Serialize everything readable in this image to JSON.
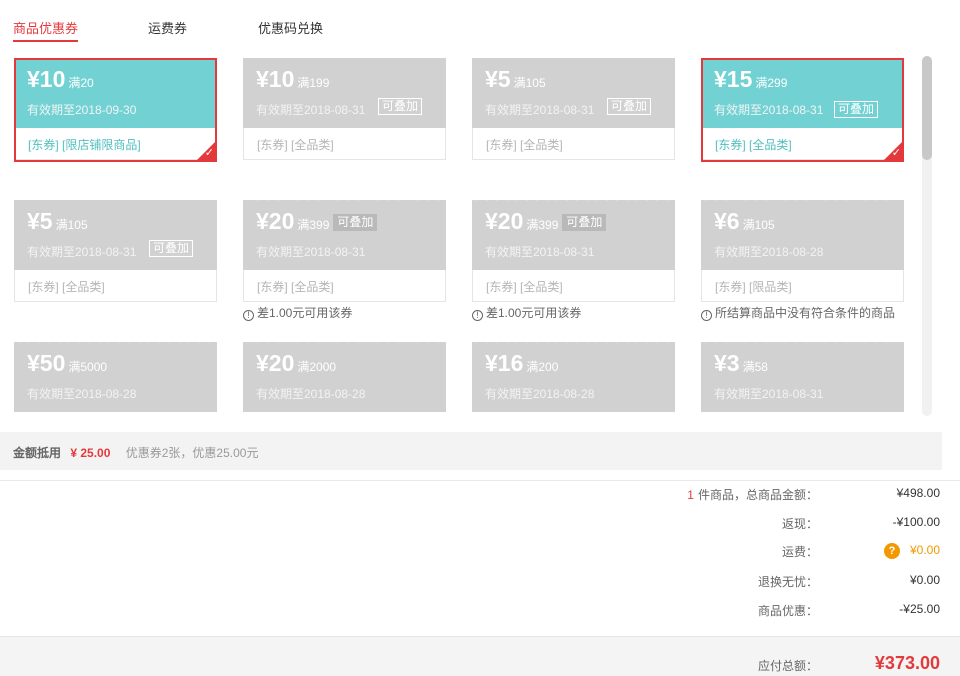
{
  "tabs": [
    {
      "label": "商品优惠券",
      "active": true
    },
    {
      "label": "运费券",
      "active": false
    },
    {
      "label": "优惠码兑换",
      "active": false
    }
  ],
  "coupons": [
    {
      "amount": "¥10",
      "condition": "满20",
      "validity": "有效期至2018-09-30",
      "stackable": "",
      "scope": "[东券]  [限店铺限商品]",
      "selected": true
    },
    {
      "amount": "¥10",
      "condition": "满199",
      "validity": "有效期至2018-08-31",
      "stackable": "可叠加",
      "scope": "[东券]  [全品类]",
      "selected": false
    },
    {
      "amount": "¥5",
      "condition": "满105",
      "validity": "有效期至2018-08-31",
      "stackable": "可叠加",
      "scope": "[东券]  [全品类]",
      "selected": false
    },
    {
      "amount": "¥15",
      "condition": "满299",
      "validity": "有效期至2018-08-31",
      "stackable": "可叠加",
      "scope": "[东券]  [全品类]",
      "selected": true
    },
    {
      "amount": "¥5",
      "condition": "满105",
      "validity": "有效期至2018-08-31",
      "stackable": "可叠加",
      "scope": "[东券]  [全品类]",
      "selected": false
    },
    {
      "amount": "¥20",
      "condition": "满399",
      "validity": "有效期至2018-08-31",
      "stackable": "可叠加",
      "scope": "[东券]  [全品类]",
      "tip": "差1.00元可用该券"
    },
    {
      "amount": "¥20",
      "condition": "满399",
      "validity": "有效期至2018-08-31",
      "stackable": "可叠加",
      "scope": "[东券]  [全品类]",
      "tip": "差1.00元可用该券"
    },
    {
      "amount": "¥6",
      "condition": "满105",
      "validity": "有效期至2018-08-28",
      "stackable": "",
      "scope": "[东券]  [限品类]",
      "tip": "所结算商品中没有符合条件的商品"
    },
    {
      "amount": "¥50",
      "condition": "满5000",
      "validity": "有效期至2018-08-28"
    },
    {
      "amount": "¥20",
      "condition": "满2000",
      "validity": "有效期至2018-08-28"
    },
    {
      "amount": "¥16",
      "condition": "满200",
      "validity": "有效期至2018-08-28"
    },
    {
      "amount": "¥3",
      "condition": "满58",
      "validity": "有效期至2018-08-31"
    }
  ],
  "summary": {
    "label": "金额抵用",
    "amount": "¥ 25.00",
    "detail": "优惠券2张，优惠25.00元"
  },
  "totals": {
    "items_count": "1",
    "items_label": "件商品，总商品金额：",
    "items_value": "¥498.00",
    "cashback_label": "返现：",
    "cashback_value": "-¥100.00",
    "shipping_label": "运费：",
    "shipping_help": "?",
    "shipping_value": "¥0.00",
    "return_label": "退换无忧：",
    "return_value": "¥0.00",
    "discount_label": "商品优惠：",
    "discount_value": "-¥25.00"
  },
  "pay": {
    "label": "应付总额：",
    "value": "¥373.00"
  },
  "colors": {
    "accent": "#e4393c",
    "selected_coupon": "#72d2d3",
    "disabled_coupon": "#d1d1d1",
    "warning": "#f39800"
  },
  "icons": {
    "check": "check-icon",
    "info": "info-icon",
    "help": "question-icon"
  }
}
